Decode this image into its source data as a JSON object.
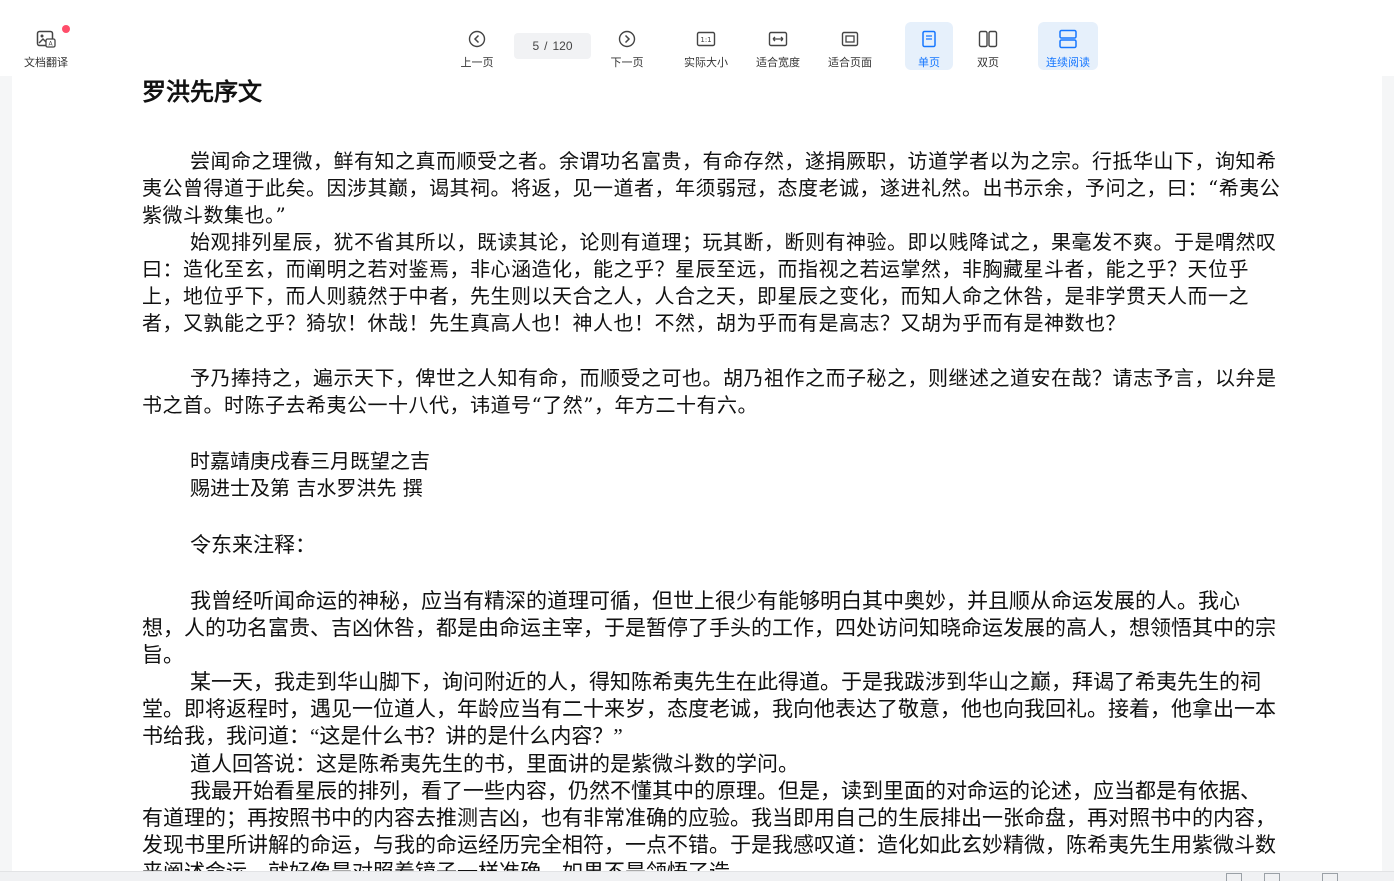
{
  "toolbar": {
    "translate_label": "文档翻译",
    "prev_label": "上一页",
    "next_label": "下一页",
    "page_current": "5",
    "page_sep": "/",
    "page_total": "120",
    "actual_size_label": "实际大小",
    "fit_width_label": "适合宽度",
    "fit_page_label": "适合页面",
    "single_label": "单页",
    "double_label": "双页",
    "continuous_label": "连续阅读",
    "accent_color": "#1677ff",
    "notification_dot_color": "#ff4d6a"
  },
  "document": {
    "title": "罗洪先序文",
    "paragraphs": [
      "尝闻命之理微，鲜有知之真而顺受之者。余谓功名富贵，有命存然，遂捐厥职，访道学者以为之宗。行抵华山下，询知希夷公曾得道于此矣。因涉其巅，谒其祠。将返，见一道者，年须弱冠，态度老诚，遂进礼然。出书示余，予问之，曰：“希夷公紫微斗数集也。”",
      "始观排列星辰，犹不省其所以，既读其论，论则有道理；玩其断，断则有神验。即以贱降试之，果毫发不爽。于是喟然叹曰：造化至玄，而阐明之若对鉴焉，非心涵造化，能之乎？星辰至远，而指视之若运掌然，非胸藏星斗者，能之乎？天位乎上，地位乎下，而人则藐然于中者，先生则以天合之人，人合之天，即星辰之变化，而知人命之休咎，是非学贯天人而一之者，又孰能之乎？猗欤！休哉！先生真高人也！神人也！不然，胡为乎而有是高志？又胡为乎而有是神数也？",
      "予乃捧持之，遍示天下，俾世之人知有命，而顺受之可也。胡乃祖作之而子秘之，则继述之道安在哉？请志予言，以弁是书之首。时陈子去希夷公一十八代，讳道号“了然”，年方二十有六。"
    ],
    "date_line": "时嘉靖庚戌春三月既望之吉",
    "sign_line": "赐进士及第 吉水罗洪先 撰",
    "note_heading": "令东来注释：",
    "notes": [
      "我曾经听闻命运的神秘，应当有精深的道理可循，但世上很少有能够明白其中奥妙，并且顺从命运发展的人。我心想，人的功名富贵、吉凶休咎，都是由命运主宰，于是暂停了手头的工作，四处访问知晓命运发展的高人，想领悟其中的宗旨。",
      "某一天，我走到华山脚下，询问附近的人，得知陈希夷先生在此得道。于是我跋涉到华山之巅，拜谒了希夷先生的祠堂。即将返程时，遇见一位道人，年龄应当有二十来岁，态度老诚，我向他表达了敬意，他也向我回礼。接着，他拿出一本书给我，我问道：“这是什么书？讲的是什么内容？”",
      "道人回答说：这是陈希夷先生的书，里面讲的是紫微斗数的学问。",
      "我最开始看星辰的排列，看了一些内容，仍然不懂其中的原理。但是，读到里面的对命运的论述，应当都是有依据、有道理的；再按照书中的内容去推测吉凶，也有非常准确的应验。我当即用自己的生辰排出一张命盘，再对照书中的内容，发现书里所讲解的命运，与我的命运经历完全相符，一点不错。于是我感叹道：造化如此玄妙精微，陈希夷先生用紫微斗数来阐述命运，就好像是对照着镜子一样准确，如果不是领悟了造"
    ]
  }
}
